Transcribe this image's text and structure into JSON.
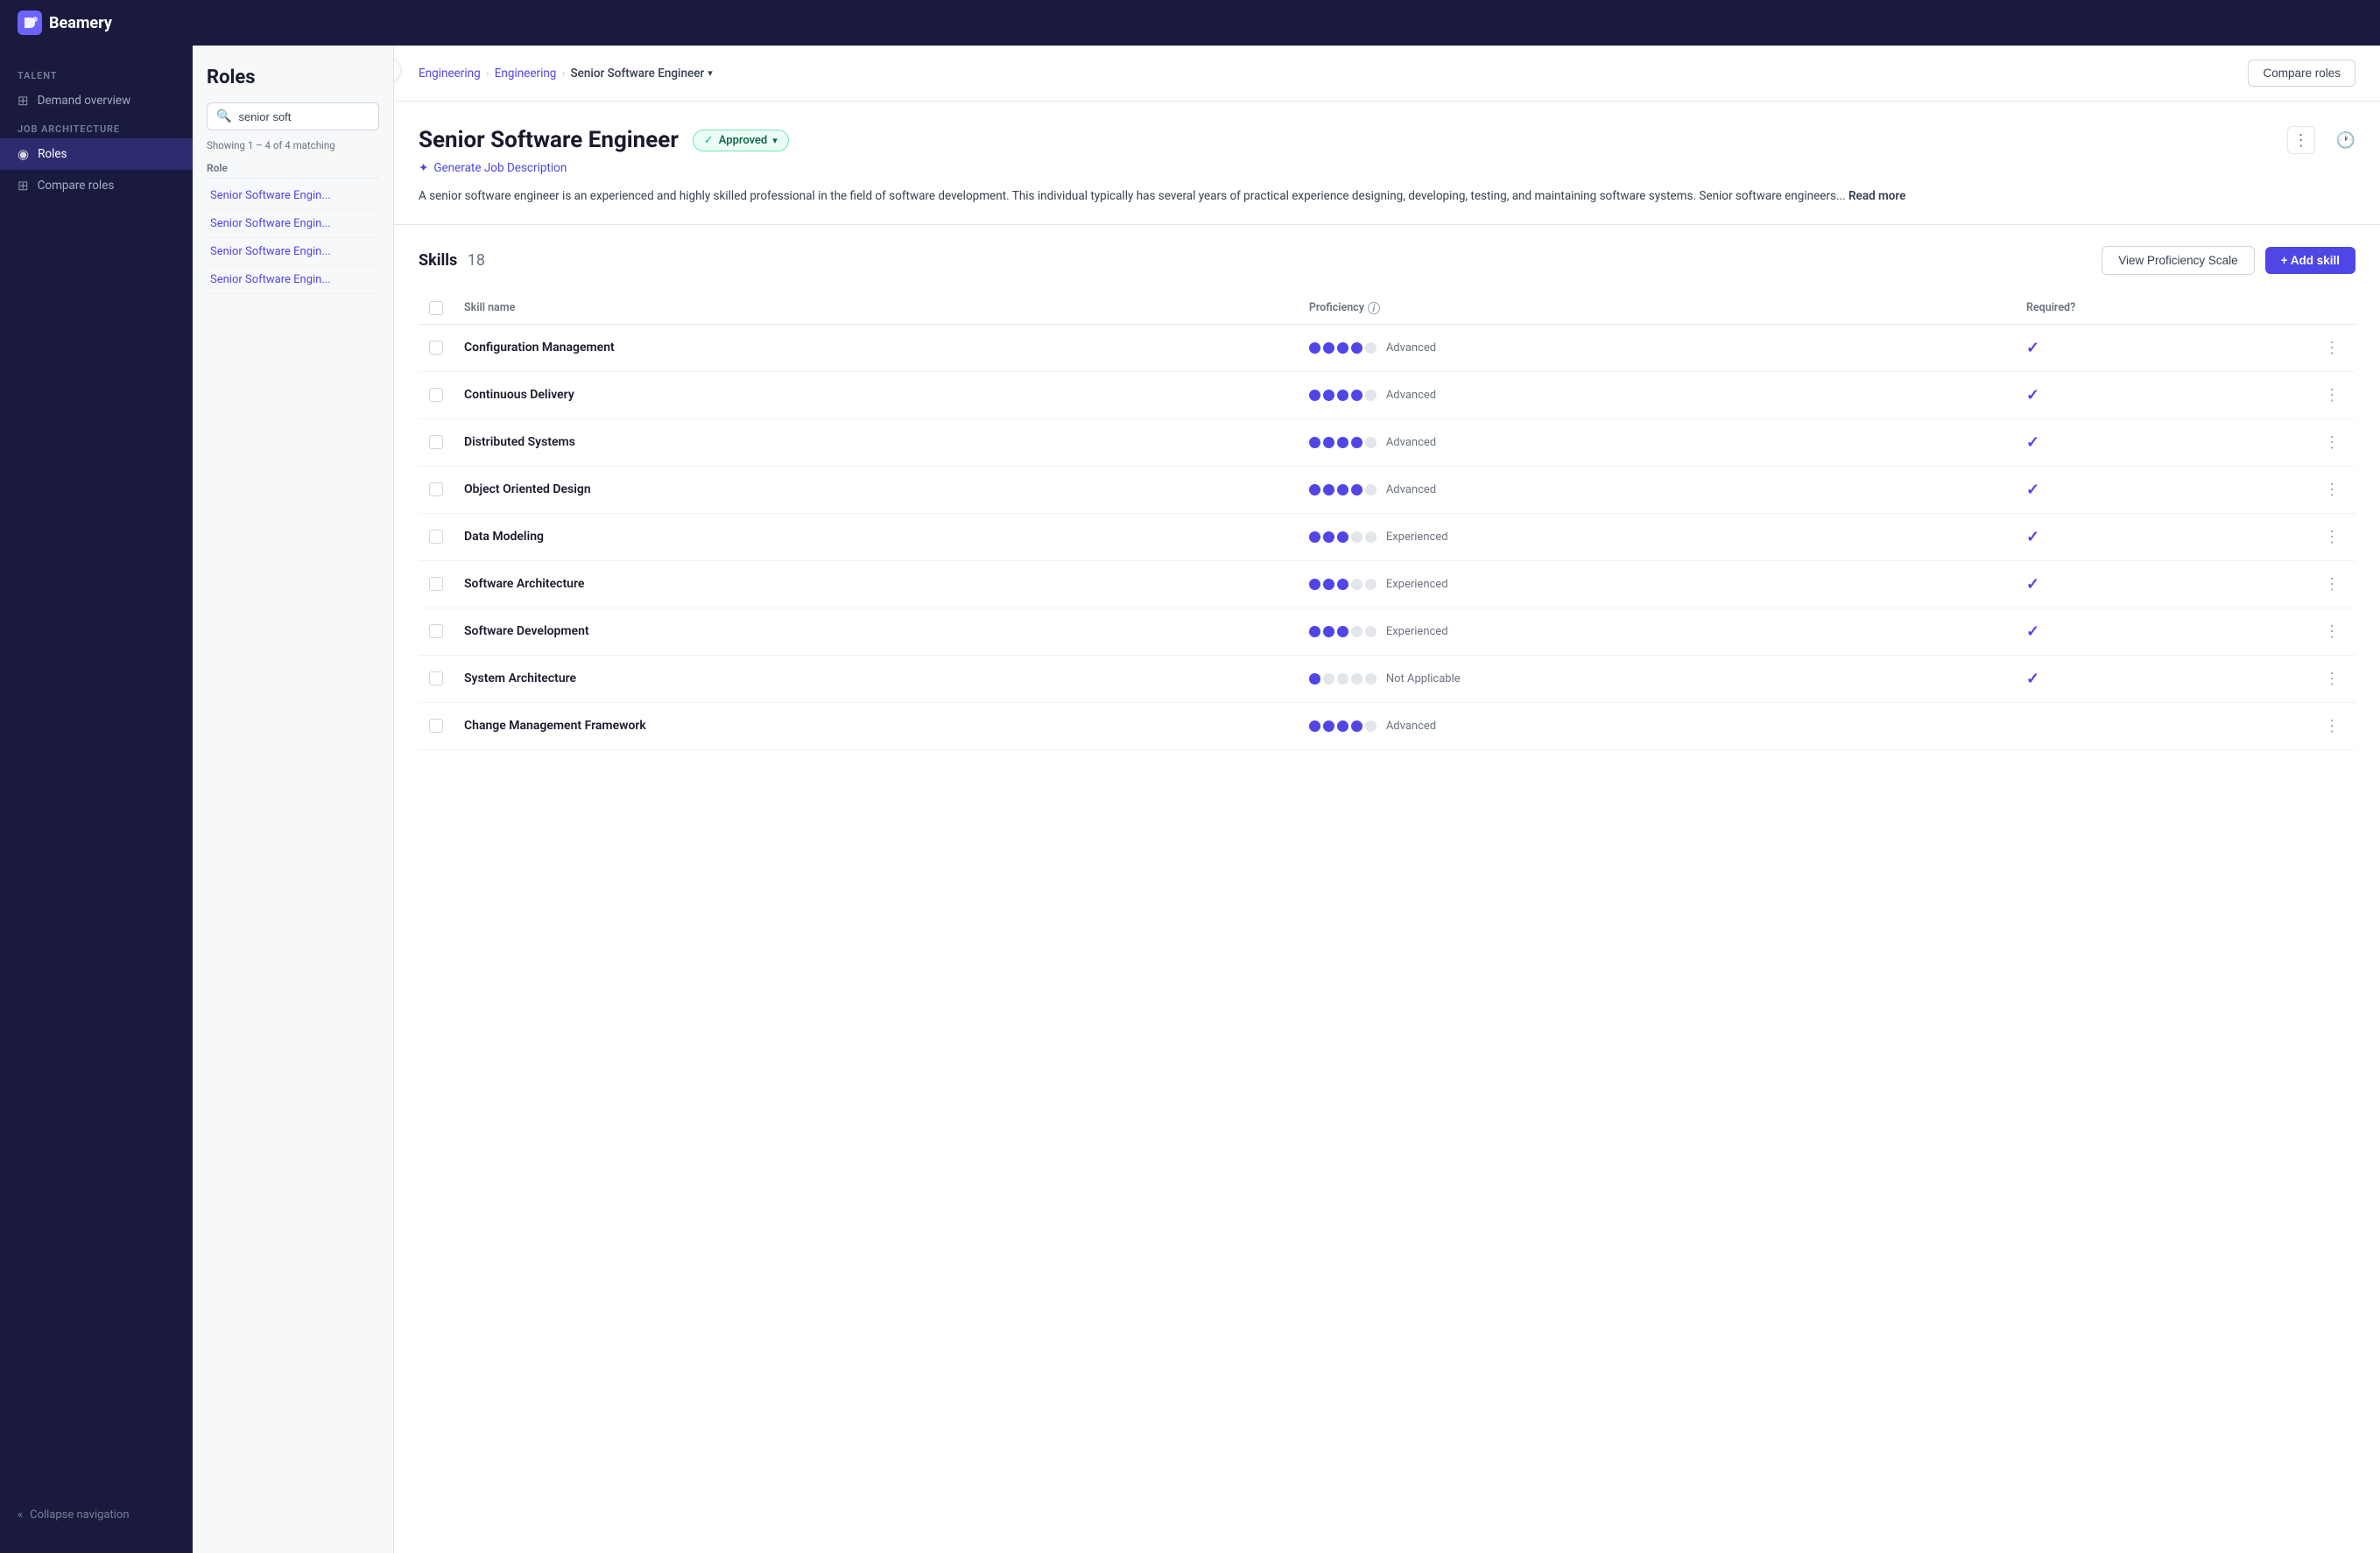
{
  "app": {
    "name": "Beamery"
  },
  "nav": {
    "talent_label": "TALENT",
    "demand_overview": "Demand overview",
    "job_architecture_label": "JOB ARCHITECTURE",
    "roles_label": "Roles",
    "compare_roles_label": "Compare roles",
    "collapse_label": "Collapse navigation"
  },
  "roles_panel": {
    "title": "Roles",
    "search_placeholder": "senior soft",
    "showing_text": "Showing 1 – 4 of 4 matching",
    "column_header": "Role",
    "roles": [
      {
        "name": "Senior Software Engin..."
      },
      {
        "name": "Senior Software Engin..."
      },
      {
        "name": "Senior Software Engin..."
      },
      {
        "name": "Senior Software Engin..."
      }
    ]
  },
  "breadcrumb": {
    "part1": "Engineering",
    "part2": "Engineering",
    "current": "Senior Software Engineer"
  },
  "compare_btn": "Compare roles",
  "role": {
    "title": "Senior Software Engineer",
    "status": "Approved",
    "generate_label": "Generate Job Description",
    "description": "A senior software engineer is an experienced and highly skilled professional in the field of software development. This individual typically has several years of practical experience designing, developing, testing, and maintaining software systems. Senior software engineers...",
    "read_more": "Read more"
  },
  "skills": {
    "label": "Skills",
    "count": "18",
    "view_proficiency_label": "View Proficiency Scale",
    "add_skill_label": "+ Add skill",
    "col_skill_name": "Skill name",
    "col_proficiency": "Proficiency",
    "col_required": "Required?",
    "items": [
      {
        "name": "Configuration Management",
        "proficiency_filled": 4,
        "proficiency_empty": 1,
        "proficiency_label": "Advanced",
        "required": true
      },
      {
        "name": "Continuous Delivery",
        "proficiency_filled": 4,
        "proficiency_empty": 1,
        "proficiency_label": "Advanced",
        "required": true
      },
      {
        "name": "Distributed Systems",
        "proficiency_filled": 4,
        "proficiency_empty": 1,
        "proficiency_label": "Advanced",
        "required": true
      },
      {
        "name": "Object Oriented Design",
        "proficiency_filled": 4,
        "proficiency_empty": 1,
        "proficiency_label": "Advanced",
        "required": true
      },
      {
        "name": "Data Modeling",
        "proficiency_filled": 3,
        "proficiency_empty": 2,
        "proficiency_label": "Experienced",
        "required": true
      },
      {
        "name": "Software Architecture",
        "proficiency_filled": 3,
        "proficiency_empty": 2,
        "proficiency_label": "Experienced",
        "required": true
      },
      {
        "name": "Software Development",
        "proficiency_filled": 3,
        "proficiency_empty": 2,
        "proficiency_label": "Experienced",
        "required": true
      },
      {
        "name": "System Architecture",
        "proficiency_filled": 1,
        "proficiency_empty": 4,
        "proficiency_label": "Not Applicable",
        "required": true
      },
      {
        "name": "Change Management Framework",
        "proficiency_filled": 4,
        "proficiency_empty": 1,
        "proficiency_label": "Advanced",
        "required": false
      }
    ]
  }
}
